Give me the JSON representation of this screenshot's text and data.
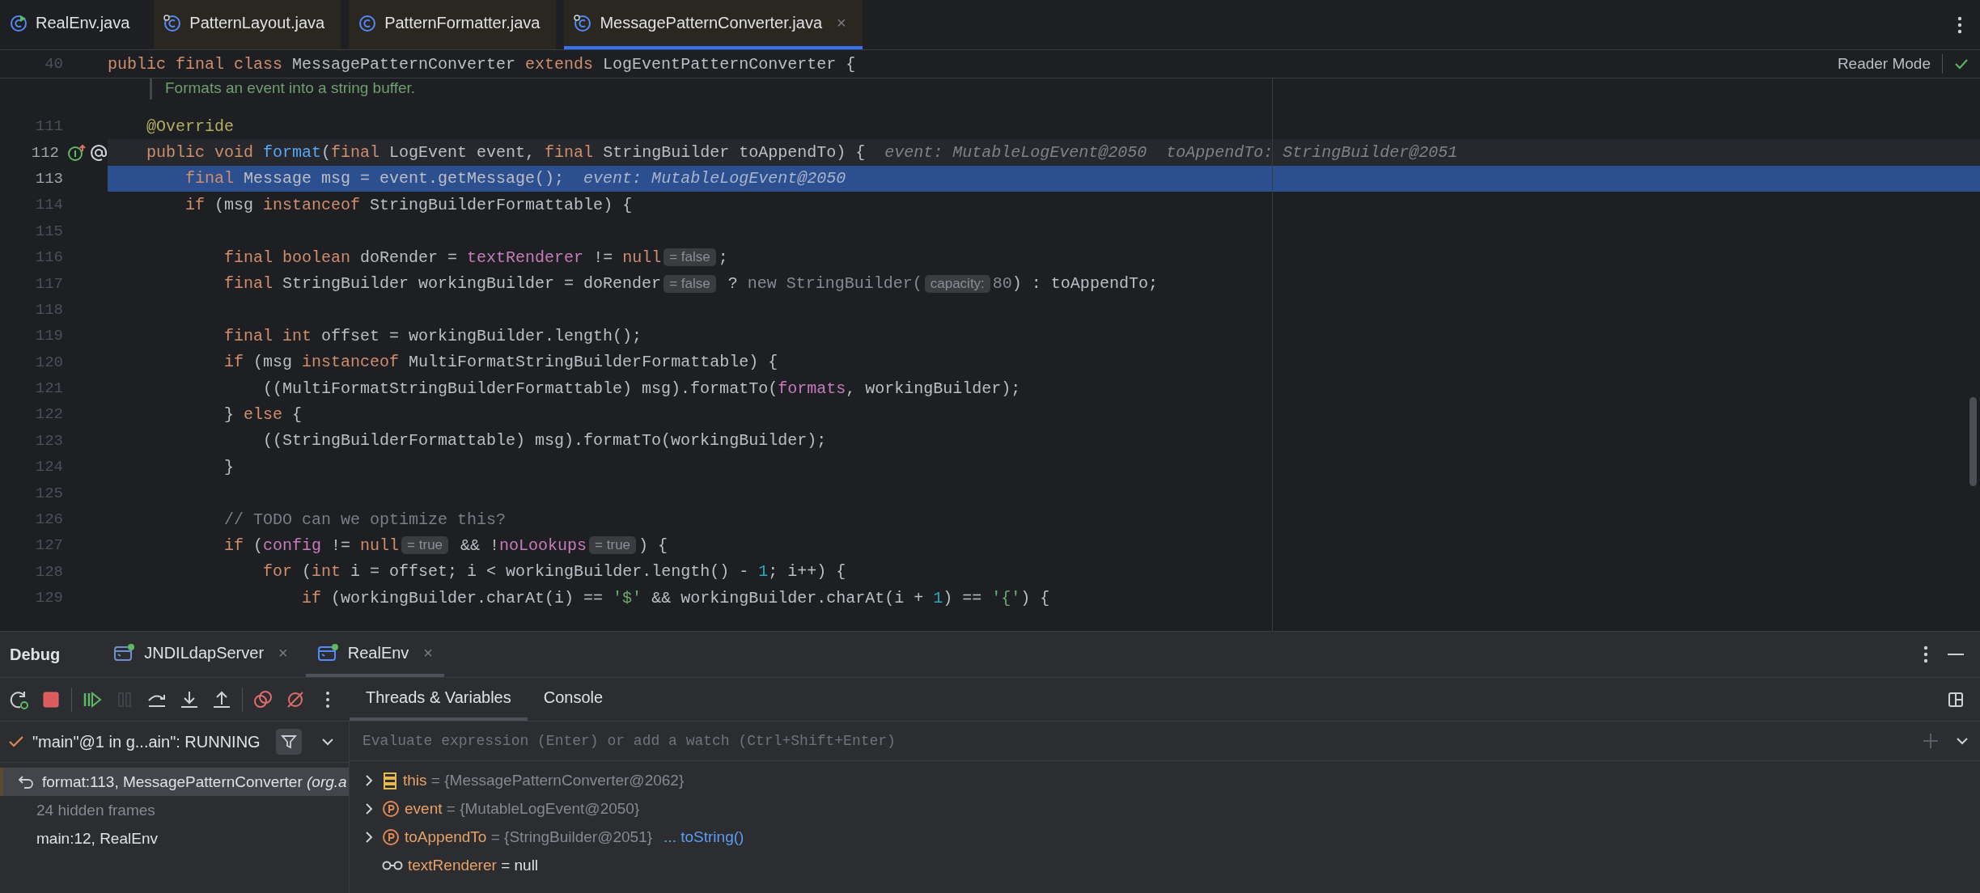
{
  "editor_tabs": [
    {
      "label": "RealEnv.java",
      "kind": "main",
      "library": false,
      "selected": false
    },
    {
      "label": "PatternLayout.java",
      "kind": "compiled",
      "library": true,
      "selected": false
    },
    {
      "label": "PatternFormatter.java",
      "kind": "source",
      "library": true,
      "selected": false
    },
    {
      "label": "MessagePatternConverter.java",
      "kind": "compiled",
      "library": true,
      "selected": true,
      "close": "×"
    }
  ],
  "reader_mode": {
    "label": "Reader Mode"
  },
  "sticky_line": {
    "number": "40",
    "segments": [
      {
        "text": "public final class ",
        "kind": "kw"
      },
      {
        "text": "MessagePatternConverter ",
        "kind": "plain"
      },
      {
        "text": "extends ",
        "kind": "kw"
      },
      {
        "text": "LogEventPatternConverter {",
        "kind": "plain"
      }
    ]
  },
  "doc_comment": "Formats an event into a string buffer.",
  "lines": [
    {
      "number": "111",
      "execution_point": false,
      "caret_line": false,
      "markers": false,
      "segments": [
        {
          "text": "    @Override",
          "kind": "ann"
        }
      ]
    },
    {
      "number": "112",
      "execution_point": false,
      "caret_line": true,
      "markers": true,
      "segments": [
        {
          "text": "    public void ",
          "kind": "kw"
        },
        {
          "text": "format",
          "kind": "fn"
        },
        {
          "text": "(",
          "kind": "plain"
        },
        {
          "text": "final ",
          "kind": "kw"
        },
        {
          "text": "LogEvent event, ",
          "kind": "plain"
        },
        {
          "text": "final ",
          "kind": "kw"
        },
        {
          "text": "StringBuilder toAppendTo) {",
          "kind": "plain"
        },
        {
          "text": "event: MutableLogEvent@2050",
          "kind": "hint"
        },
        {
          "text": "toAppendTo: StringBuilder@2051",
          "kind": "hint"
        }
      ]
    },
    {
      "number": "113",
      "execution_point": true,
      "caret_line": false,
      "markers": false,
      "segments": [
        {
          "text": "        final ",
          "kind": "kw"
        },
        {
          "text": "Message msg = event.getMessage();",
          "kind": "plain"
        },
        {
          "text": "event: MutableLogEvent@2050",
          "kind": "hint"
        }
      ]
    },
    {
      "number": "114",
      "execution_point": false,
      "caret_line": false,
      "markers": false,
      "segments": [
        {
          "text": "        if ",
          "kind": "kw"
        },
        {
          "text": "(msg ",
          "kind": "plain"
        },
        {
          "text": "instanceof ",
          "kind": "kw"
        },
        {
          "text": "StringBuilderFormattable) {",
          "kind": "plain"
        }
      ]
    },
    {
      "number": "115",
      "execution_point": false,
      "caret_line": false,
      "markers": false
    },
    {
      "number": "116",
      "execution_point": false,
      "caret_line": false,
      "markers": false,
      "segments": [
        {
          "text": "            final boolean ",
          "kind": "kw"
        },
        {
          "text": "doRender = ",
          "kind": "plain"
        },
        {
          "text": "textRenderer",
          "kind": "field"
        },
        {
          "text": " != ",
          "kind": "plain"
        },
        {
          "text": "null",
          "kind": "kw"
        },
        {
          "text": "= false",
          "kind": "inlay"
        },
        {
          "text": ";",
          "kind": "plain"
        }
      ]
    },
    {
      "number": "117",
      "execution_point": false,
      "caret_line": false,
      "markers": false,
      "segments": [
        {
          "text": "            final ",
          "kind": "kw"
        },
        {
          "text": "StringBuilder workingBuilder = doRender",
          "kind": "plain"
        },
        {
          "text": "= false",
          "kind": "inlay"
        },
        {
          "text": " ? ",
          "kind": "plain"
        },
        {
          "text": "new StringBuilder(",
          "kind": "dim"
        },
        {
          "text": "capacity:",
          "kind": "inlay"
        },
        {
          "text": "80",
          "kind": "dim"
        },
        {
          "text": ") : toAppendTo;",
          "kind": "plain"
        }
      ]
    },
    {
      "number": "118",
      "execution_point": false,
      "caret_line": false,
      "markers": false
    },
    {
      "number": "119",
      "execution_point": false,
      "caret_line": false,
      "markers": false,
      "segments": [
        {
          "text": "            final int ",
          "kind": "kw"
        },
        {
          "text": "offset = workingBuilder.length();",
          "kind": "plain"
        }
      ]
    },
    {
      "number": "120",
      "execution_point": false,
      "caret_line": false,
      "markers": false,
      "segments": [
        {
          "text": "            if ",
          "kind": "kw"
        },
        {
          "text": "(msg ",
          "kind": "plain"
        },
        {
          "text": "instanceof ",
          "kind": "kw"
        },
        {
          "text": "MultiFormatStringBuilderFormattable) {",
          "kind": "plain"
        }
      ]
    },
    {
      "number": "121",
      "execution_point": false,
      "caret_line": false,
      "markers": false,
      "segments": [
        {
          "text": "                ((MultiFormatStringBuilderFormattable) msg).formatTo(",
          "kind": "plain"
        },
        {
          "text": "formats",
          "kind": "field"
        },
        {
          "text": ", workingBuilder);",
          "kind": "plain"
        }
      ]
    },
    {
      "number": "122",
      "execution_point": false,
      "caret_line": false,
      "markers": false,
      "segments": [
        {
          "text": "            } ",
          "kind": "plain"
        },
        {
          "text": "else ",
          "kind": "kw"
        },
        {
          "text": "{",
          "kind": "plain"
        }
      ]
    },
    {
      "number": "123",
      "execution_point": false,
      "caret_line": false,
      "markers": false,
      "segments": [
        {
          "text": "                ((StringBuilderFormattable) msg).formatTo(workingBuilder);",
          "kind": "plain"
        }
      ]
    },
    {
      "number": "124",
      "execution_point": false,
      "caret_line": false,
      "markers": false,
      "segments": [
        {
          "text": "            }",
          "kind": "plain"
        }
      ]
    },
    {
      "number": "125",
      "execution_point": false,
      "caret_line": false,
      "markers": false
    },
    {
      "number": "126",
      "execution_point": false,
      "caret_line": false,
      "markers": false,
      "segments": [
        {
          "text": "            // TODO can we optimize this?",
          "kind": "comment"
        }
      ]
    },
    {
      "number": "127",
      "execution_point": false,
      "caret_line": false,
      "markers": false,
      "segments": [
        {
          "text": "            if ",
          "kind": "kw"
        },
        {
          "text": "(",
          "kind": "plain"
        },
        {
          "text": "config",
          "kind": "field"
        },
        {
          "text": " != ",
          "kind": "plain"
        },
        {
          "text": "null",
          "kind": "kw"
        },
        {
          "text": "= true",
          "kind": "inlay"
        },
        {
          "text": " && !",
          "kind": "plain"
        },
        {
          "text": "noLookups",
          "kind": "field"
        },
        {
          "text": "= true",
          "kind": "inlay"
        },
        {
          "text": ") {",
          "kind": "plain"
        }
      ]
    },
    {
      "number": "128",
      "execution_point": false,
      "caret_line": false,
      "markers": false,
      "segments": [
        {
          "text": "                for ",
          "kind": "kw"
        },
        {
          "text": "(",
          "kind": "plain"
        },
        {
          "text": "int ",
          "kind": "kw"
        },
        {
          "text": "i = offset; i < workingBuilder.length() - ",
          "kind": "plain"
        },
        {
          "text": "1",
          "kind": "num"
        },
        {
          "text": "; i++) {",
          "kind": "plain"
        }
      ]
    },
    {
      "number": "129",
      "execution_point": false,
      "caret_line": false,
      "markers": false,
      "segments": [
        {
          "text": "                    if ",
          "kind": "kw"
        },
        {
          "text": "(workingBuilder.charAt(i) == ",
          "kind": "plain"
        },
        {
          "text": "'$'",
          "kind": "str"
        },
        {
          "text": " && workingBuilder.charAt(i + ",
          "kind": "plain"
        },
        {
          "text": "1",
          "kind": "num"
        },
        {
          "text": ") == ",
          "kind": "plain"
        },
        {
          "text": "'{'",
          "kind": "str"
        },
        {
          "text": ") {",
          "kind": "plain"
        }
      ]
    }
  ],
  "debug": {
    "title": "Debug",
    "sessions": [
      {
        "label": "JNDILdapServer",
        "selected": false,
        "close": "×"
      },
      {
        "label": "RealEnv",
        "selected": true,
        "close": "×"
      }
    ],
    "toolbar": [
      {
        "kind": "rerun",
        "disabled": false
      },
      {
        "kind": "stop",
        "disabled": false
      },
      {
        "kind": "separator"
      },
      {
        "kind": "resume",
        "disabled": false
      },
      {
        "kind": "pause",
        "disabled": true
      },
      {
        "kind": "step-over",
        "disabled": false
      },
      {
        "kind": "step-into",
        "disabled": false
      },
      {
        "kind": "step-out",
        "disabled": false
      },
      {
        "kind": "separator"
      },
      {
        "kind": "breakpoints",
        "disabled": false
      },
      {
        "kind": "mute",
        "disabled": false
      },
      {
        "kind": "more",
        "disabled": false
      }
    ],
    "view_tabs": [
      {
        "label": "Threads & Variables",
        "selected": true
      },
      {
        "label": "Console",
        "selected": false
      }
    ],
    "thread": "\"main\"@1 in g...ain\": RUNNING",
    "frames": [
      {
        "text": "format:113, MessagePatternConverter *(org.a*",
        "kind": "current",
        "selected": true
      },
      {
        "text": "24 hidden frames",
        "kind": "hidden",
        "selected": false
      },
      {
        "text": "main:12, RealEnv",
        "kind": "frame",
        "selected": false
      }
    ],
    "evaluate": {
      "placeholder": "Evaluate expression (Enter) or add a watch (Ctrl+Shift+Enter)"
    },
    "variables": [
      {
        "name": "this",
        "kind": "this",
        "expandable": true,
        "value": "= {MessagePatternConverter@2062}"
      },
      {
        "name": "event",
        "kind": "param",
        "expandable": true,
        "value": "= {MutableLogEvent@2050}"
      },
      {
        "name": "toAppendTo",
        "kind": "param",
        "expandable": true,
        "value": "= {StringBuilder@2051}",
        "link": "... toString()"
      },
      {
        "name": "textRenderer",
        "kind": "field",
        "expandable": false,
        "value": "= null"
      }
    ]
  }
}
